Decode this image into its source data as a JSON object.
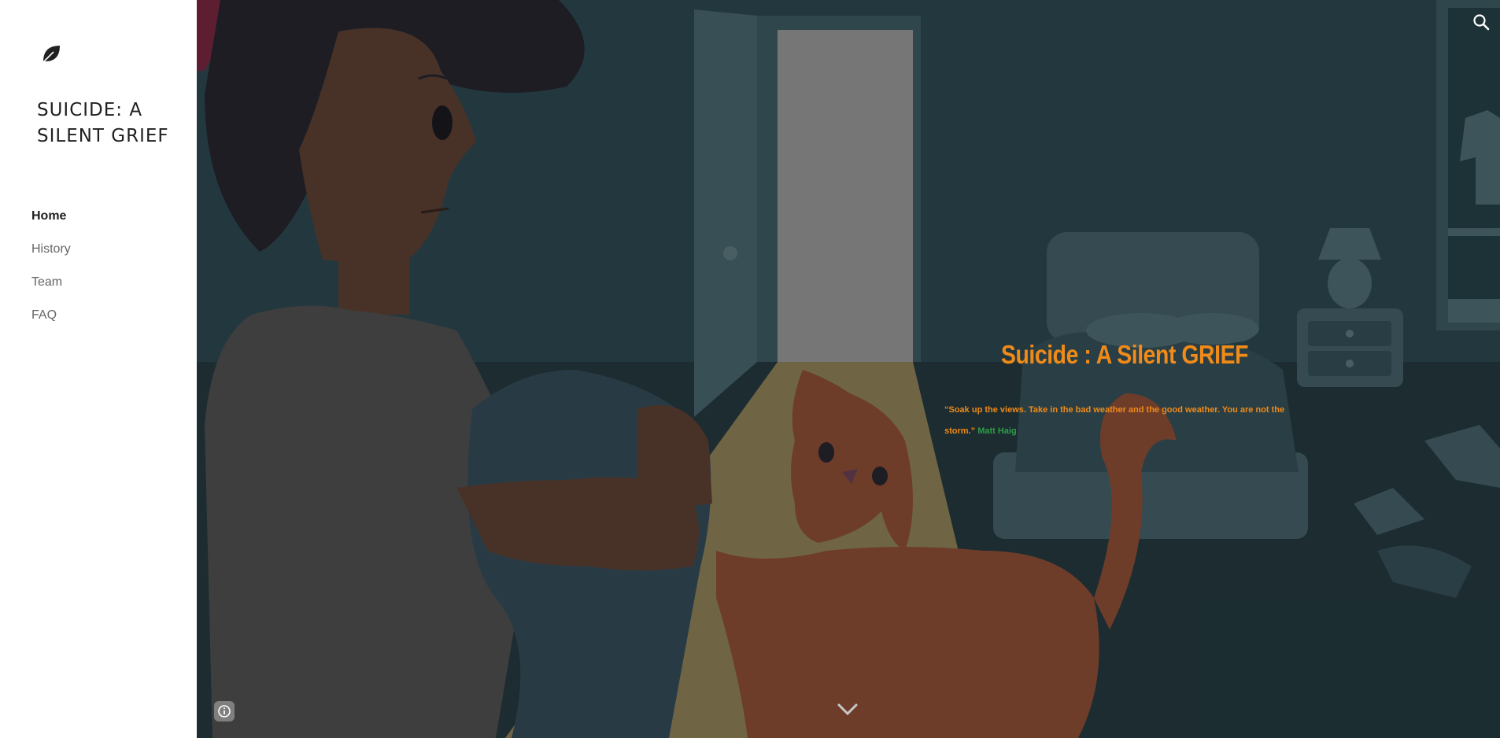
{
  "site": {
    "title": "SUICIDE: A SILENT GRIEF",
    "logo_icon": "leaf-icon"
  },
  "nav": {
    "items": [
      {
        "label": "Home",
        "active": true
      },
      {
        "label": "History",
        "active": false
      },
      {
        "label": "Team",
        "active": false
      },
      {
        "label": "FAQ",
        "active": false
      }
    ]
  },
  "hero": {
    "title": "Suicide : A Silent GRIEF",
    "quote_text": "“Soak up the views. Take in the bad weather and the good weather. You are not the storm.” ",
    "quote_author": "Matt Haig",
    "search_icon": "search-icon",
    "info_icon": "info-icon",
    "scroll_icon": "chevron-down-icon"
  },
  "colors": {
    "title_accent": "#f08a18",
    "author_accent": "#2e9d4a",
    "sidebar_bg": "#ffffff"
  }
}
